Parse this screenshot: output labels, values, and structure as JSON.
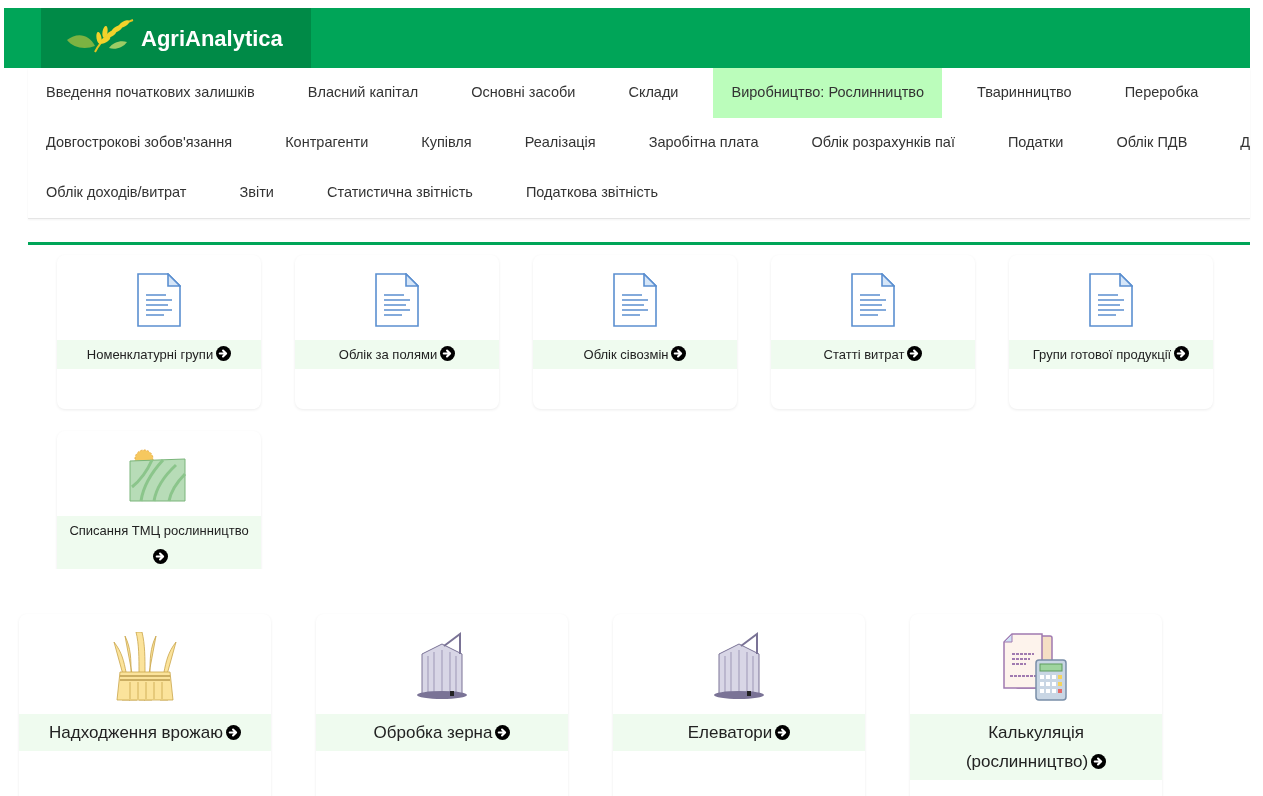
{
  "header": {
    "logo_text": "AgriAnalytica"
  },
  "nav": {
    "items": [
      {
        "label": "Введення початкових залишків",
        "selected": false
      },
      {
        "label": "Власний капітал",
        "selected": false
      },
      {
        "label": "Основні засоби",
        "selected": false
      },
      {
        "label": "Склади",
        "selected": false
      },
      {
        "label": "Виробництво: Рослинництво",
        "selected": true
      },
      {
        "label": "Тваринництво",
        "selected": false
      },
      {
        "label": "Переробка",
        "selected": false
      },
      {
        "label": "Довгострокові зобов'язання",
        "selected": false
      },
      {
        "label": "Контрагенти",
        "selected": false
      },
      {
        "label": "Купівля",
        "selected": false
      },
      {
        "label": "Реалізація",
        "selected": false
      },
      {
        "label": "Заробітна плата",
        "selected": false
      },
      {
        "label": "Облік розрахунків паї",
        "selected": false
      },
      {
        "label": "Податки",
        "selected": false
      },
      {
        "label": "Облік ПДВ",
        "selected": false
      },
      {
        "label": "Д",
        "selected": false
      },
      {
        "label": "Облік доходів/витрат",
        "selected": false
      },
      {
        "label": "Звіти",
        "selected": false
      },
      {
        "label": "Статистична звітність",
        "selected": false
      },
      {
        "label": "Податкова звітність",
        "selected": false
      }
    ]
  },
  "directories": [
    {
      "kind": "document",
      "label": "Номенклатурні групи"
    },
    {
      "kind": "document",
      "label": "Облік за полями"
    },
    {
      "kind": "document",
      "label": "Облік сівозмін"
    },
    {
      "kind": "document",
      "label": "Статті витрат"
    },
    {
      "kind": "document",
      "label": "Групи готової продукції"
    },
    {
      "kind": "field",
      "label": "Списання ТМЦ рослинництво"
    }
  ],
  "operations": [
    {
      "kind": "sheaf",
      "label": "Надходження врожаю"
    },
    {
      "kind": "silo",
      "label": "Обробка зерна"
    },
    {
      "kind": "silo",
      "label": "Елеватори"
    },
    {
      "kind": "calculation",
      "label": "Калькуляція (рослинництво)"
    }
  ]
}
